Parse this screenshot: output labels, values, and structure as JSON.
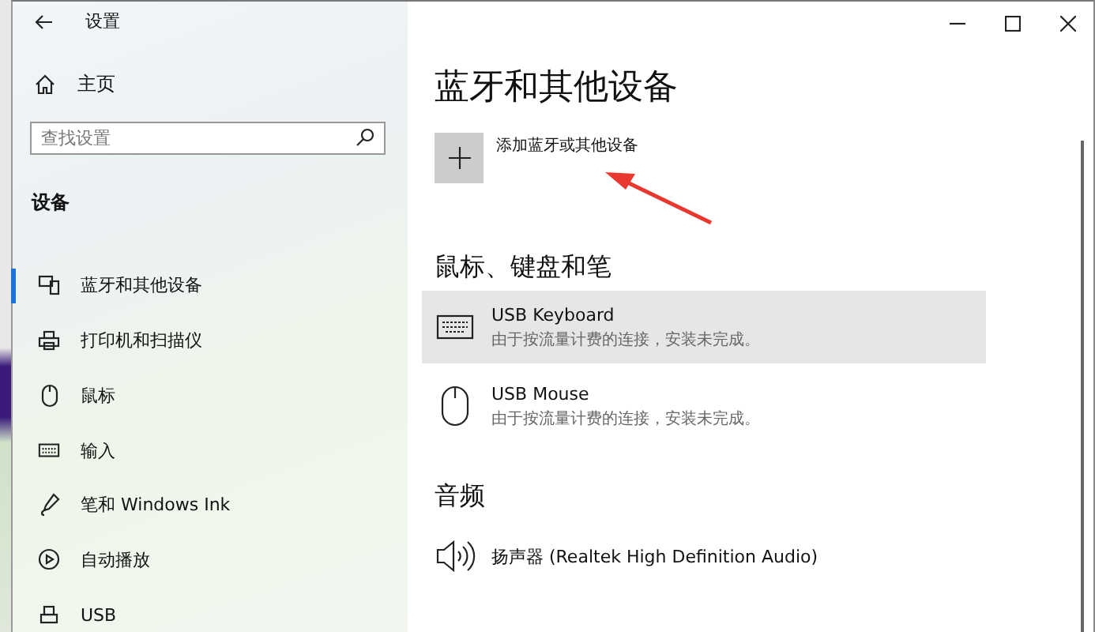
{
  "window": {
    "title": "设置"
  },
  "sidebar": {
    "home": "主页",
    "search": {
      "placeholder": "查找设置"
    },
    "section": "设备",
    "items": [
      {
        "label": "蓝牙和其他设备",
        "kind": "bluetooth",
        "selected": true
      },
      {
        "label": "打印机和扫描仪",
        "kind": "printer",
        "selected": false
      },
      {
        "label": "鼠标",
        "kind": "mouse",
        "selected": false
      },
      {
        "label": "输入",
        "kind": "keyboard",
        "selected": false
      },
      {
        "label": "笔和 Windows Ink",
        "kind": "pen",
        "selected": false
      },
      {
        "label": "自动播放",
        "kind": "autoplay",
        "selected": false
      },
      {
        "label": "USB",
        "kind": "usb",
        "selected": false
      }
    ]
  },
  "main": {
    "heading": "蓝牙和其他设备",
    "add_button": {
      "label": "添加蓝牙或其他设备"
    },
    "sections": [
      {
        "title": "鼠标、键盘和笔",
        "devices": [
          {
            "name": "USB Keyboard",
            "status": "由于按流量计费的连接，安装未完成。",
            "kind": "keyboard",
            "selected": true
          },
          {
            "name": "USB Mouse",
            "status": "由于按流量计费的连接，安装未完成。",
            "kind": "mouse",
            "selected": false
          }
        ]
      },
      {
        "title": "音频",
        "devices": [
          {
            "name": "扬声器 (Realtek High Definition Audio)",
            "kind": "speaker",
            "selected": false
          }
        ]
      }
    ]
  }
}
